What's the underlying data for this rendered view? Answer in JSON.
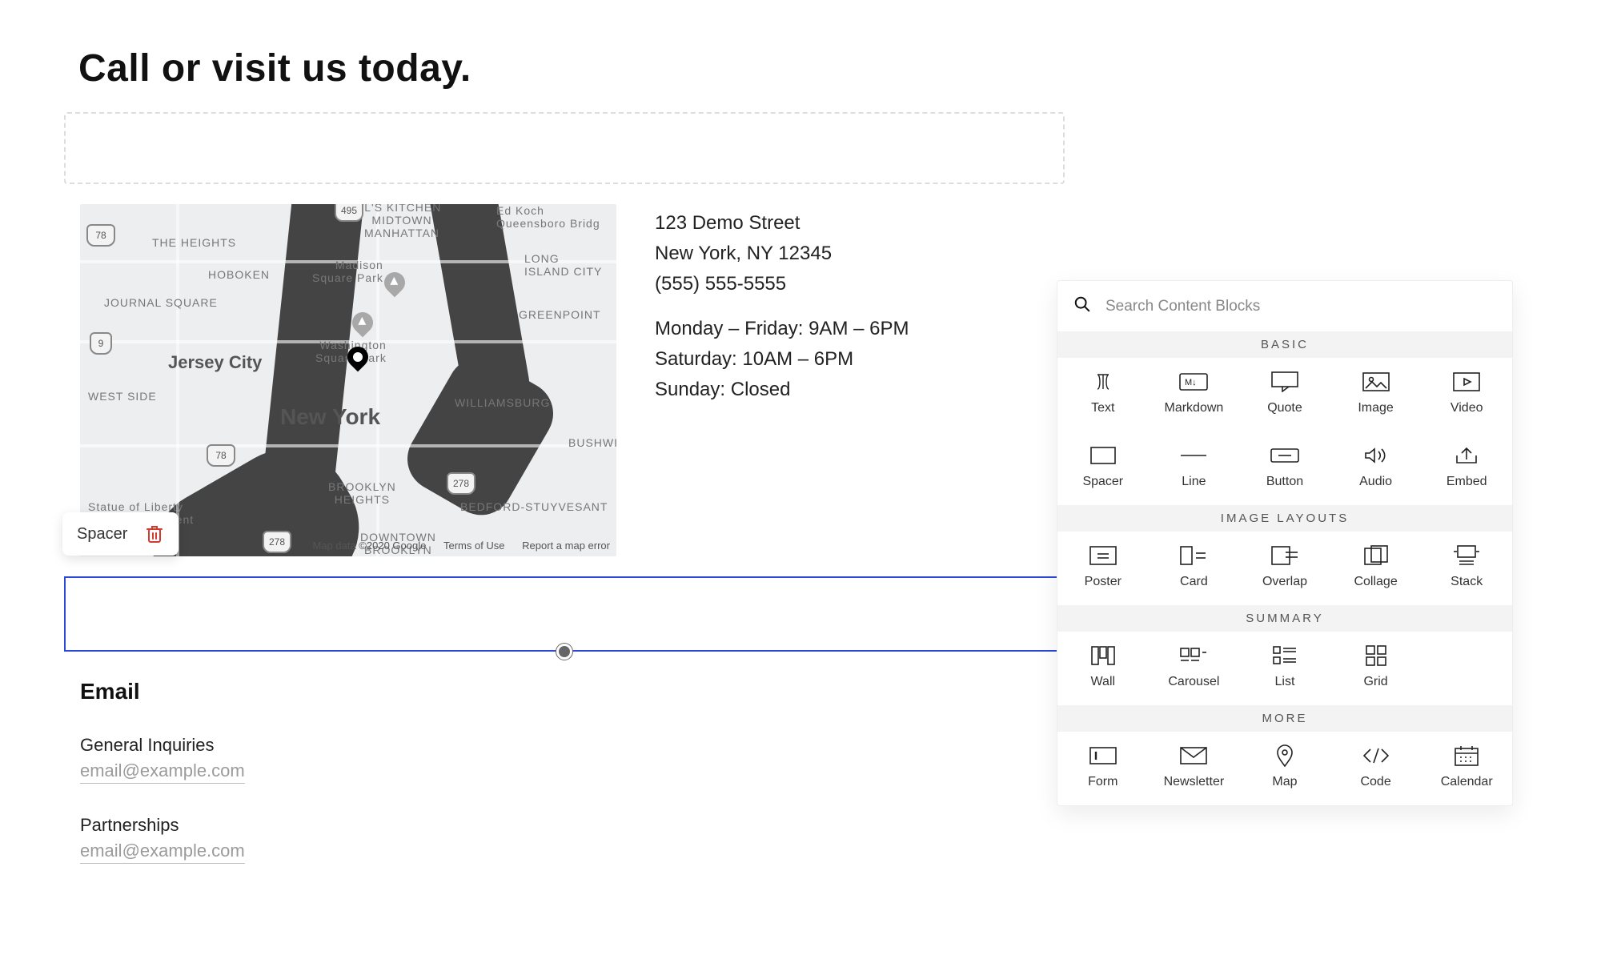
{
  "page": {
    "title": "Call or visit us today."
  },
  "address": {
    "line1": "123 Demo Street",
    "line2": "New York, NY 12345",
    "phone": "(555) 555-5555",
    "hours1": "Monday – Friday: 9AM – 6PM",
    "hours2": "Saturday: 10AM – 6PM",
    "hours3": "Sunday: Closed"
  },
  "map": {
    "attrib_data": "Map data ©2020 Google",
    "attrib_terms": "Terms of Use",
    "attrib_report": "Report a map error",
    "labels": {
      "nyc": "New York",
      "jersey": "Jersey City",
      "hoboken": "HOBOKEN",
      "heights": "THE HEIGHTS",
      "journal": "JOURNAL SQUARE",
      "westside": "WEST SIDE",
      "midtown": "MIDTOWN\nMANHATTAN",
      "hellsk": "HELL'S KITCHEN",
      "edkoch": "Ed Koch\nQueensboro Bridg",
      "lic": "LONG\nISLAND CITY",
      "greenpoint": "GREENPOINT",
      "williamsburg": "WILLIAMSBURG",
      "bushwi": "BUSHWI",
      "bkheights": "BROOKLYN\nHEIGHTS",
      "bedstuy": "BEDFORD-STUYVESANT",
      "downtownbk": "DOWNTOWN\nBROOKLYN",
      "msp": "Madison\nSquare Park",
      "wsp": "Washington\nSquare Park",
      "liberty": "Statue of Liberty\nIational Monument",
      "r78a": "78",
      "r78b": "78",
      "r495": "495",
      "r278a": "278",
      "r278b": "278",
      "r9": "9"
    }
  },
  "toolbar": {
    "spacer_label": "Spacer"
  },
  "email": {
    "heading": "Email",
    "sub1": "General Inquiries",
    "link1": "email@example.com",
    "sub2": "Partnerships",
    "link2": "email@example.com"
  },
  "picker": {
    "search_placeholder": "Search Content Blocks",
    "sections": {
      "basic": "BASIC",
      "image_layouts": "IMAGE LAYOUTS",
      "summary": "SUMMARY",
      "more": "MORE"
    },
    "basic": {
      "text": "Text",
      "markdown": "Markdown",
      "quote": "Quote",
      "image": "Image",
      "video": "Video",
      "spacer": "Spacer",
      "line": "Line",
      "button": "Button",
      "audio": "Audio",
      "embed": "Embed"
    },
    "image_layouts": {
      "poster": "Poster",
      "card": "Card",
      "overlap": "Overlap",
      "collage": "Collage",
      "stack": "Stack"
    },
    "summary": {
      "wall": "Wall",
      "carousel": "Carousel",
      "list": "List",
      "grid": "Grid"
    },
    "more": {
      "form": "Form",
      "newsletter": "Newsletter",
      "map": "Map",
      "code": "Code",
      "calendar": "Calendar"
    }
  }
}
